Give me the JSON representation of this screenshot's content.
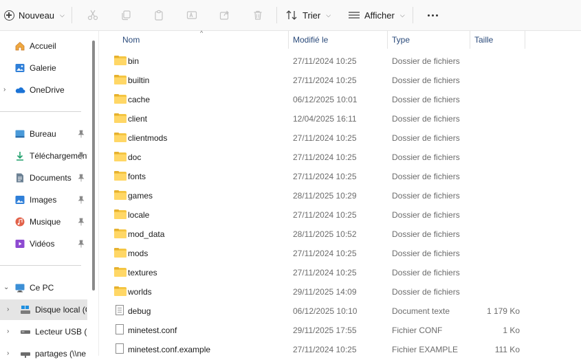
{
  "toolbar": {
    "new_label": "Nouveau",
    "sort_label": "Trier",
    "view_label": "Afficher",
    "icons": [
      "cut-icon",
      "copy-icon",
      "paste-icon",
      "rename-icon",
      "share-icon",
      "delete-icon"
    ]
  },
  "sidebar": {
    "top": [
      {
        "label": "Accueil",
        "icon": "home-icon"
      },
      {
        "label": "Galerie",
        "icon": "gallery-icon"
      },
      {
        "label": "OneDrive",
        "icon": "onedrive-icon"
      }
    ],
    "pinned": [
      {
        "label": "Bureau",
        "icon": "desktop-icon"
      },
      {
        "label": "Téléchargements",
        "icon": "download-icon"
      },
      {
        "label": "Documents",
        "icon": "documents-icon"
      },
      {
        "label": "Images",
        "icon": "images-icon"
      },
      {
        "label": "Musique",
        "icon": "music-icon"
      },
      {
        "label": "Vidéos",
        "icon": "videos-icon"
      }
    ],
    "devices": [
      {
        "label": "Ce PC",
        "icon": "pc-icon"
      },
      {
        "label": "Disque local (C:)",
        "icon": "drive-icon"
      },
      {
        "label": "Lecteur USB (E:)",
        "icon": "usb-drive-icon"
      },
      {
        "label": "partages (\\\\ne",
        "icon": "network-drive-icon"
      }
    ]
  },
  "columns": {
    "name": "Nom",
    "modified": "Modifié le",
    "type": "Type",
    "size": "Taille"
  },
  "files": [
    {
      "name": "bin",
      "date": "27/11/2024 10:25",
      "type": "Dossier de fichiers",
      "size": "",
      "kind": "folder"
    },
    {
      "name": "builtin",
      "date": "27/11/2024 10:25",
      "type": "Dossier de fichiers",
      "size": "",
      "kind": "folder"
    },
    {
      "name": "cache",
      "date": "06/12/2025 10:01",
      "type": "Dossier de fichiers",
      "size": "",
      "kind": "folder"
    },
    {
      "name": "client",
      "date": "12/04/2025 16:11",
      "type": "Dossier de fichiers",
      "size": "",
      "kind": "folder"
    },
    {
      "name": "clientmods",
      "date": "27/11/2024 10:25",
      "type": "Dossier de fichiers",
      "size": "",
      "kind": "folder"
    },
    {
      "name": "doc",
      "date": "27/11/2024 10:25",
      "type": "Dossier de fichiers",
      "size": "",
      "kind": "folder"
    },
    {
      "name": "fonts",
      "date": "27/11/2024 10:25",
      "type": "Dossier de fichiers",
      "size": "",
      "kind": "folder"
    },
    {
      "name": "games",
      "date": "28/11/2025 10:29",
      "type": "Dossier de fichiers",
      "size": "",
      "kind": "folder"
    },
    {
      "name": "locale",
      "date": "27/11/2024 10:25",
      "type": "Dossier de fichiers",
      "size": "",
      "kind": "folder"
    },
    {
      "name": "mod_data",
      "date": "28/11/2025 10:52",
      "type": "Dossier de fichiers",
      "size": "",
      "kind": "folder"
    },
    {
      "name": "mods",
      "date": "27/11/2024 10:25",
      "type": "Dossier de fichiers",
      "size": "",
      "kind": "folder"
    },
    {
      "name": "textures",
      "date": "27/11/2024 10:25",
      "type": "Dossier de fichiers",
      "size": "",
      "kind": "folder"
    },
    {
      "name": "worlds",
      "date": "29/11/2025 14:09",
      "type": "Dossier de fichiers",
      "size": "",
      "kind": "folder"
    },
    {
      "name": "debug",
      "date": "06/12/2025 10:10",
      "type": "Document texte",
      "size": "1 179 Ko",
      "kind": "text"
    },
    {
      "name": "minetest.conf",
      "date": "29/11/2025 17:55",
      "type": "Fichier CONF",
      "size": "1 Ko",
      "kind": "file"
    },
    {
      "name": "minetest.conf.example",
      "date": "27/11/2024 10:25",
      "type": "Fichier EXAMPLE",
      "size": "111 Ko",
      "kind": "file"
    }
  ]
}
